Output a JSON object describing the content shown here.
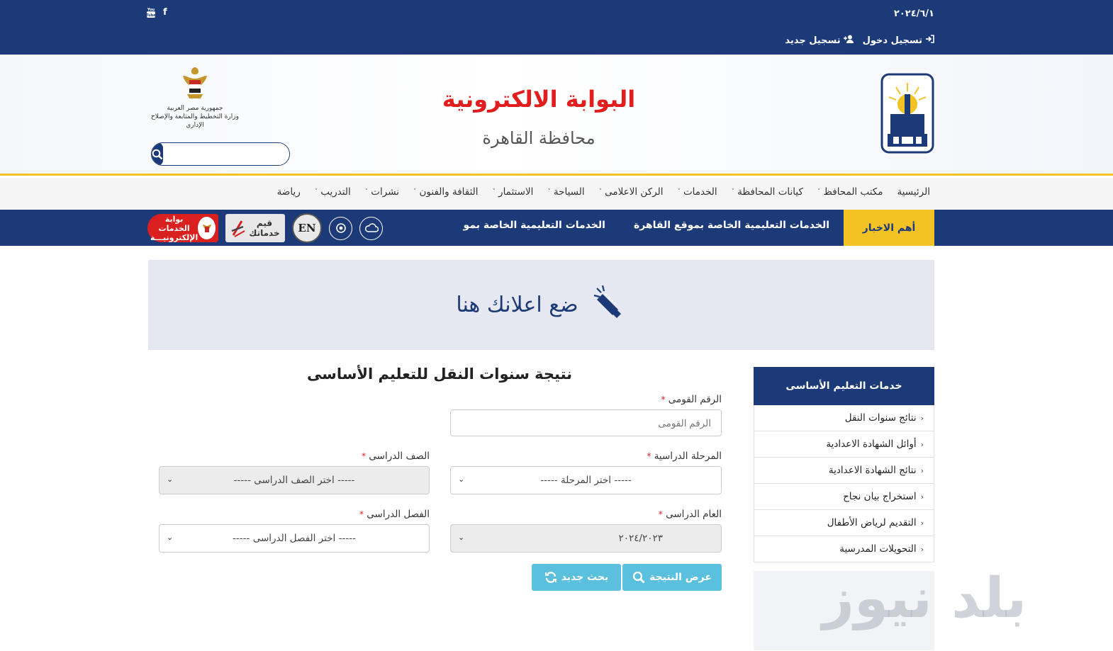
{
  "topbar": {
    "date": "٢٠٢٤/٦/١",
    "login_label": "تسجيل دخول",
    "register_label": "تسجيل جديد",
    "social": {
      "facebook": "f",
      "youtube": "You Tube"
    }
  },
  "header": {
    "site_title": "البوابة الالكترونية",
    "site_subtitle": "محافظة القاهرة",
    "emblem_line1": "جمهورية مصر العربية",
    "emblem_line2": "وزارة التخطيط والمتابعة والإصلاح الإداري",
    "search_placeholder": ""
  },
  "nav": {
    "items": [
      {
        "label": "الرئيسية",
        "dropdown": false
      },
      {
        "label": "مكتب المحافظ",
        "dropdown": true
      },
      {
        "label": "كيانات المحافظة",
        "dropdown": true
      },
      {
        "label": "الخدمات",
        "dropdown": true
      },
      {
        "label": "الركن الاعلامى",
        "dropdown": true
      },
      {
        "label": "السياحة",
        "dropdown": true
      },
      {
        "label": "الاستثمار",
        "dropdown": true
      },
      {
        "label": "الثقافة والفنون",
        "dropdown": true
      },
      {
        "label": "نشرات",
        "dropdown": true
      },
      {
        "label": "التدريب",
        "dropdown": true
      },
      {
        "label": "رياضة",
        "dropdown": false
      }
    ]
  },
  "news": {
    "label": "أهم الاخبار",
    "items": [
      "الخدمات التعليمية الخاصة بموقع القاهرة",
      "الخدمات التعليمية الخاصة بمو"
    ],
    "en_label": "EN",
    "rate_label_1": "قيم",
    "rate_label_2": "خدماتك",
    "egov_label_1": "بوابة الخدمات",
    "egov_label_2": "الإلكترونيـــة"
  },
  "ad": {
    "text": "ضع اعلانك هنا"
  },
  "sidebar": {
    "title": "خدمات التعليم الأساسى",
    "items": [
      "نتائج سنوات النقل",
      "أوائل الشهادة الاعدادية",
      "نتائج الشهادة الاعدادية",
      "استخراج بيان نجاح",
      "التقديم لرياض الأطفال",
      "التحويلات المدرسية"
    ]
  },
  "watermark": "بلد نيوز",
  "form": {
    "title": "نتيجة سنوات النقل للتعليم الأساسى",
    "national_id_label": "الرقم القومى",
    "national_id_placeholder": "الرقم القومى",
    "stage_label": "المرحلة الدراسية",
    "stage_value": "----- اختر المرحلة -----",
    "grade_label": "الصف الدراسى",
    "grade_value": "----- اختر الصف الدراسى -----",
    "year_label": "العام الدراسى",
    "year_value": "٢٠٢٤/٢٠٢٣",
    "term_label": "الفصل الدراسى",
    "term_value": "----- اختر الفصل الدراسى -----",
    "required_mark": "*",
    "show_result_label": "عرض النتيجة",
    "new_search_label": "بحث جديد"
  },
  "colors": {
    "primary": "#1d3a78",
    "accent": "#f3c325",
    "title_red": "#e21d1d",
    "button": "#5bc0de"
  }
}
